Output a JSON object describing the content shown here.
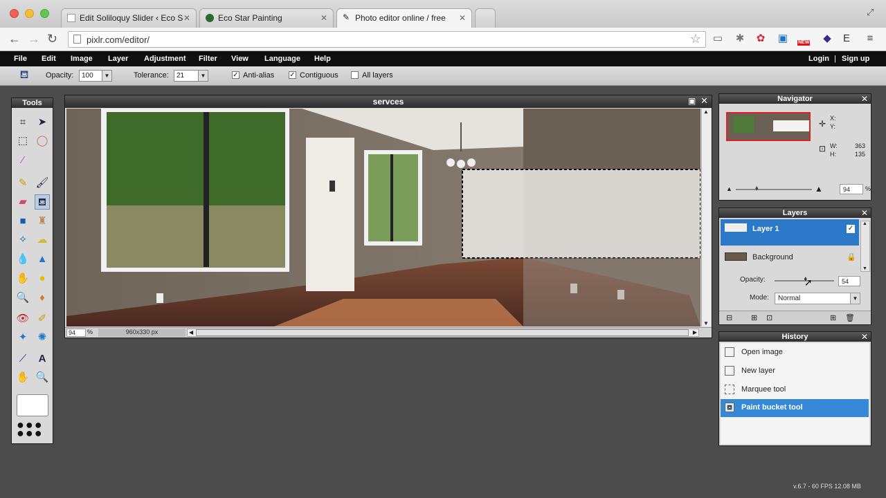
{
  "browser": {
    "tabs": [
      {
        "label": "Edit Soliloquy Slider ‹ Eco S",
        "active": false
      },
      {
        "label": "Eco Star Painting",
        "active": false
      },
      {
        "label": "Photo editor online / free",
        "active": true
      }
    ],
    "url": "pixlr.com/editor/",
    "new_badge": "NEW"
  },
  "menu": {
    "items": [
      "File",
      "Edit",
      "Image",
      "Layer",
      "Adjustment",
      "Filter",
      "View",
      "Language",
      "Help"
    ],
    "login": "Login",
    "separator": "|",
    "signup": "Sign up"
  },
  "options": {
    "opacity_label": "Opacity:",
    "opacity_value": "100",
    "tolerance_label": "Tolerance:",
    "tolerance_value": "21",
    "anti_alias": "Anti-alias",
    "contiguous": "Contiguous",
    "all_layers": "All layers"
  },
  "tools_panel": {
    "title": "Tools"
  },
  "document": {
    "title": "servces",
    "zoom": "94",
    "zoom_unit": "%",
    "size": "960x330 px"
  },
  "navigator": {
    "title": "Navigator",
    "x_label": "X:",
    "y_label": "Y:",
    "w_label": "W:",
    "h_label": "H:",
    "w_value": "363",
    "h_value": "135",
    "zoom": "94",
    "zoom_unit": "%"
  },
  "layers": {
    "title": "Layers",
    "items": [
      {
        "name": "Layer 1",
        "selected": true
      },
      {
        "name": "Background",
        "selected": false
      }
    ],
    "opacity_label": "Opacity:",
    "opacity_value": "54",
    "opacity_level": 0.54,
    "mode_label": "Mode:",
    "mode_value": "Normal"
  },
  "history": {
    "title": "History",
    "items": [
      {
        "label": "Open image",
        "selected": false
      },
      {
        "label": "New layer",
        "selected": false
      },
      {
        "label": "Marquee tool",
        "selected": false
      },
      {
        "label": "Paint bucket tool",
        "selected": true
      }
    ]
  },
  "status": "v.6.7 - 60 FPS 12.08 MB",
  "colors": {
    "accent": "#2c79c9",
    "menubar": "#0f0f0f",
    "workspace": "#4c4c4c"
  }
}
